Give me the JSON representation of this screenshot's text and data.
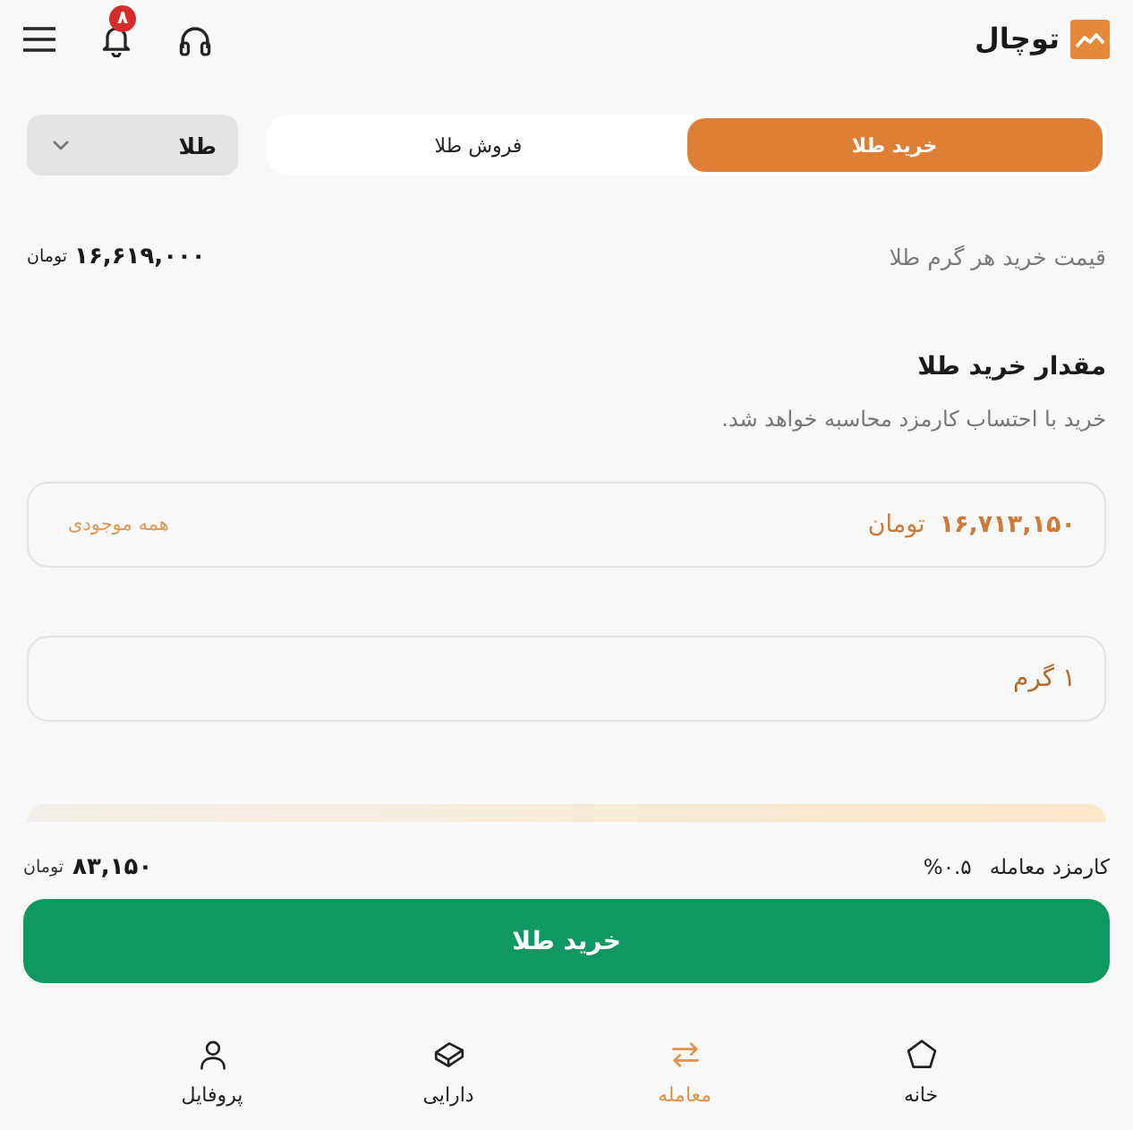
{
  "header": {
    "logo": {
      "text": "توچال"
    },
    "notifications": {
      "count": "۸"
    }
  },
  "tabs": [
    {
      "label": "خرید طلا",
      "selected": true
    },
    {
      "label": "فروش طلا",
      "selected": false
    }
  ],
  "asset_select": {
    "value": "طلا"
  },
  "price": {
    "label": "قیمت خرید هر گرم طلا",
    "value": "۱۶,۶۱۹,۰۰۰",
    "unit": "تومان"
  },
  "amount": {
    "title": "مقدار خرید طلا",
    "subtitle": "خرید با احتساب کارمزد محاسبه خواهد شد.",
    "toman_field": {
      "value": "۱۶,۷۱۳,۱۵۰",
      "unit": "تومان",
      "action": "همه موجودی"
    },
    "gram_field": {
      "value": "۱ گرم"
    }
  },
  "fee": {
    "label": "کارمزد معامله",
    "percent": "%۰.۵",
    "value": "۸۳,۱۵۰",
    "unit": "تومان"
  },
  "submit": {
    "label": "خرید طلا"
  },
  "bottom_nav": [
    {
      "label": "خانه",
      "selected": false
    },
    {
      "label": "معامله",
      "selected": true
    },
    {
      "label": "دارایی",
      "selected": false
    },
    {
      "label": "پروفایل",
      "selected": false
    }
  ]
}
